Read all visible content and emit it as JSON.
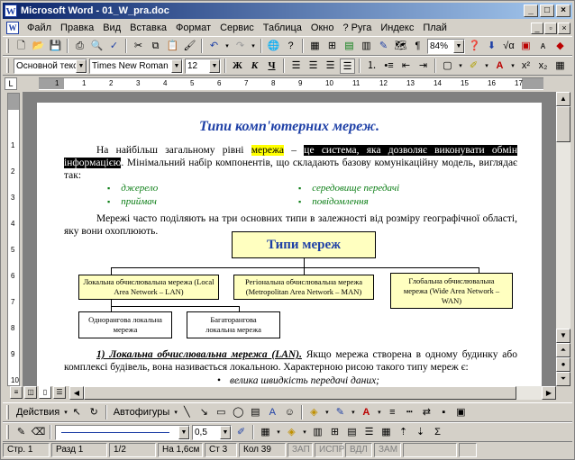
{
  "window": {
    "title": "Microsoft Word - 01_W_pra.doc",
    "app_icon": "W"
  },
  "menu": [
    "Файл",
    "Правка",
    "Вид",
    "Вставка",
    "Формат",
    "Сервис",
    "Таблица",
    "Окно",
    "? Руга",
    "Индекс",
    "Плай"
  ],
  "toolbar": {
    "zoom": "84%"
  },
  "format": {
    "style": "Основной текст",
    "font": "Times New Roman",
    "size": "12"
  },
  "doc": {
    "title": "Типи комп'ютерних мереж.",
    "p1_a": "На найбільш загальному рівні ",
    "p1_hl": "мережа",
    "p1_b": " – ",
    "p1_sel": "це система, яка дозволяє виконувати обмін інформацією",
    "p1_c": ". Мінімальний набір компонентів, що складають базову комунікаційну модель, виглядає так:",
    "bullets_left": [
      "джерело",
      "приймач"
    ],
    "bullets_right": [
      "середовище передачі",
      "повідомлення"
    ],
    "p2": "Мережі часто поділяють на три основних типи в залежності від розміру географічної області, яку вони охоплюють.",
    "diagram": {
      "root": "Типи мереж",
      "lan": "Локальна обчислювальна мережа (Local Area Network – LAN)",
      "man": "Регіональна обчислювальна мережа (Metropolitan Area Network – MAN)",
      "wan": "Глобальна обчислювальна мережа (Wide Area Network – WAN)",
      "single": "Однорангова локальна мережа",
      "multi": "Багаторангова локальна мережа"
    },
    "p3_heading": "1) Локальна обчислювальна мережа (LAN).",
    "p3_text": " Якщо мережа створена в одному будинку або комплексі будівель, вона називається локальною. Характерною рисою такого типу мереж є:",
    "bullet_last": "велика швидкість передачі даних;"
  },
  "drawbar": {
    "actions": "Действия",
    "autoshapes": "Автофигуры",
    "line_width": "0,5"
  },
  "status": {
    "page": "Стр. 1",
    "section": "Разд 1",
    "pages": "1/2",
    "at": "На 1,6см",
    "line": "Ст 3",
    "col": "Кол 39",
    "rec": "ЗАП",
    "trk": "ИСПР",
    "ext": "ВДЛ",
    "ovr": "ЗАМ"
  },
  "colors": {
    "title_blue": "#1d3fa6",
    "bullet_green": "#0a7d14",
    "box_yellow": "#ffffc0",
    "highlight": "#ffff00"
  }
}
